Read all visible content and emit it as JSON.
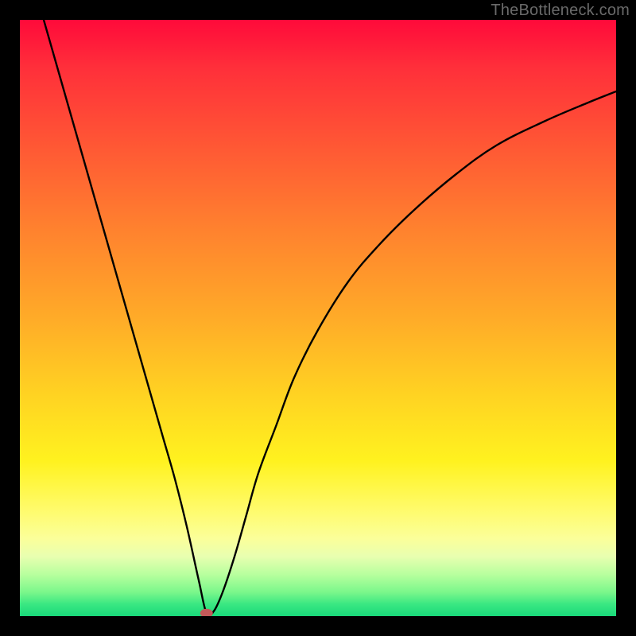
{
  "watermark": "TheBottleneck.com",
  "chart_data": {
    "type": "line",
    "title": "",
    "xlabel": "",
    "ylabel": "",
    "xlim": [
      0,
      100
    ],
    "ylim": [
      0,
      100
    ],
    "grid": false,
    "series": [
      {
        "name": "curve",
        "x": [
          4,
          6,
          8,
          10,
          12,
          14,
          16,
          18,
          20,
          22,
          24,
          26,
          28,
          30,
          31.3,
          32.5,
          34,
          36,
          38,
          40,
          43,
          46,
          50,
          55,
          60,
          66,
          73,
          80,
          88,
          95,
          100
        ],
        "values": [
          100,
          93,
          86,
          79,
          72,
          65,
          58,
          51,
          44,
          37,
          30,
          23,
          15,
          6,
          0.5,
          0.8,
          4,
          10,
          17,
          24,
          32,
          40,
          48,
          56,
          62,
          68,
          74,
          79,
          83,
          86,
          88
        ]
      }
    ],
    "marker": {
      "x": 31.3,
      "y": 0.5,
      "color": "#c45a5a"
    },
    "comment": "Values estimated from pixel positions; axes have no tick labels in source image."
  }
}
